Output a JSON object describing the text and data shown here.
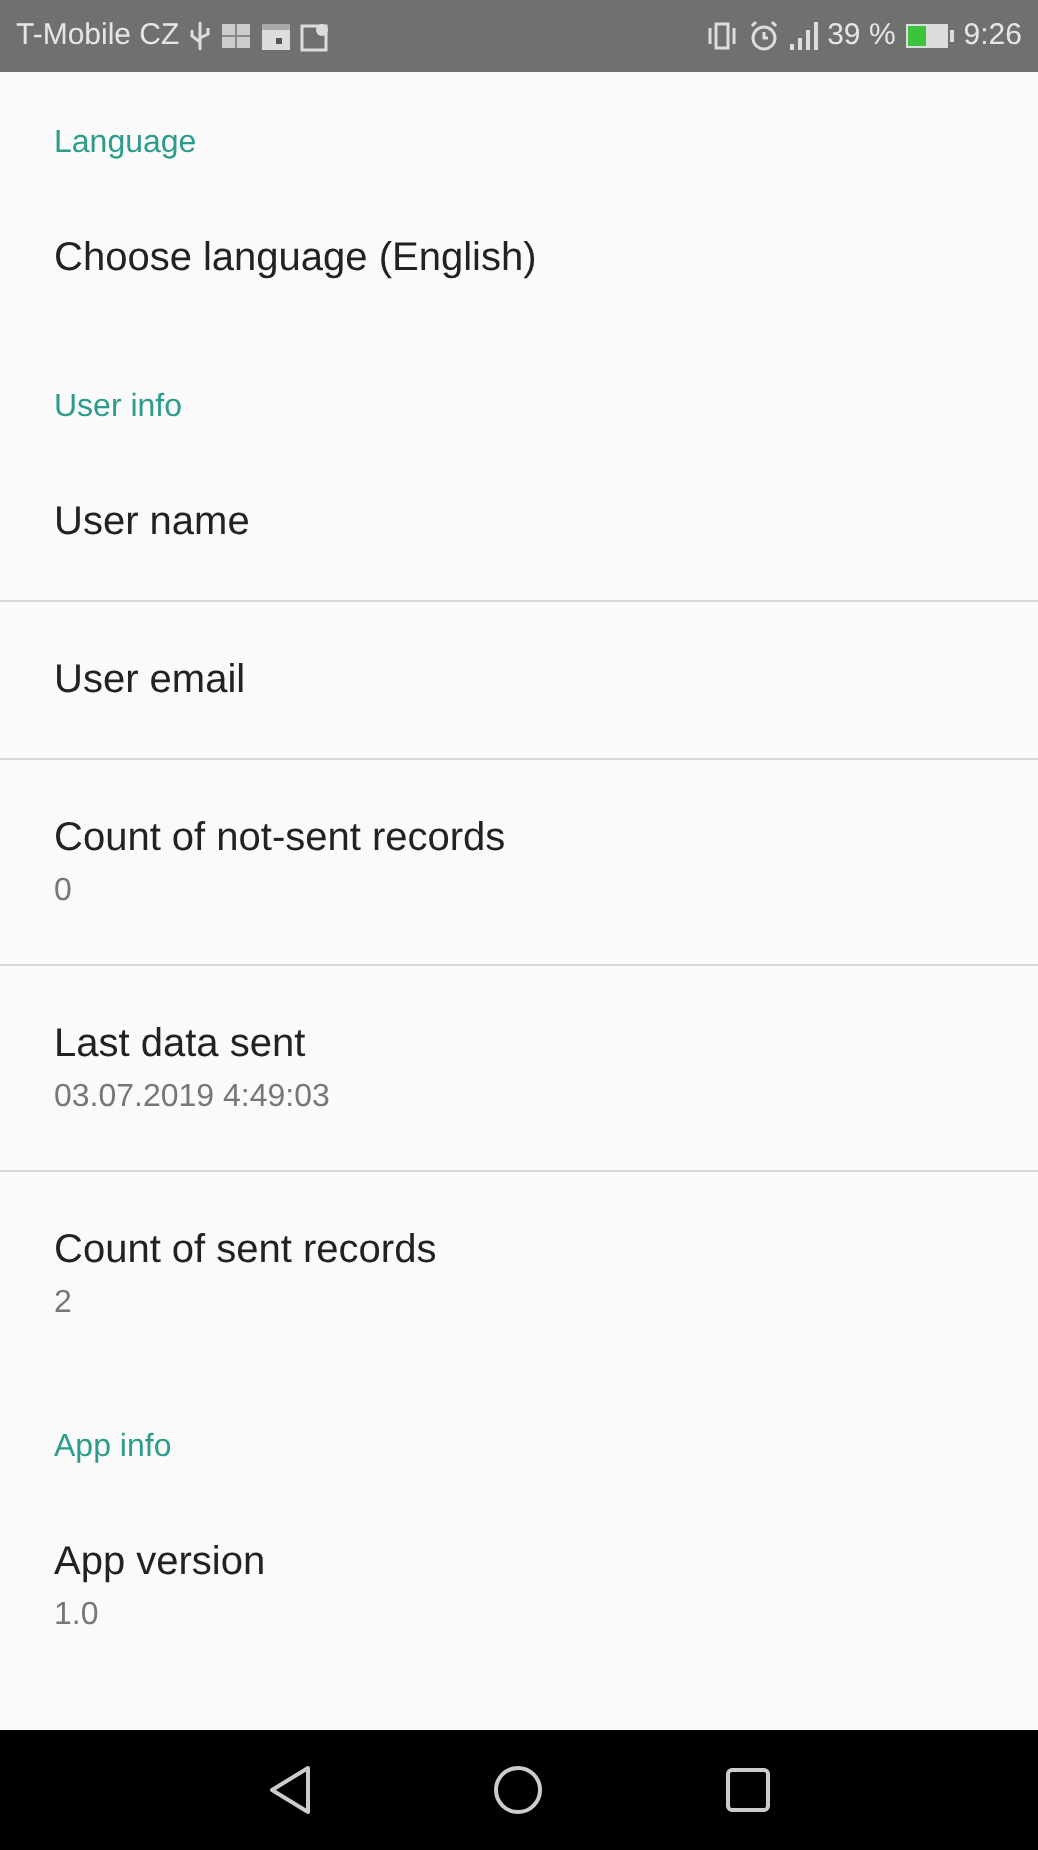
{
  "status_bar": {
    "carrier": "T-Mobile CZ",
    "battery_percent": "39 %",
    "time": "9:26"
  },
  "groups": [
    {
      "title": "Language",
      "items": [
        {
          "title": "Choose language (English)"
        }
      ]
    },
    {
      "title": "User info",
      "items": [
        {
          "title": "User name"
        },
        {
          "title": "User email"
        },
        {
          "title": "Count of not-sent records",
          "summary": "0"
        },
        {
          "title": "Last data sent",
          "summary": "03.07.2019 4:49:03"
        },
        {
          "title": "Count of sent records",
          "summary": "2"
        }
      ]
    },
    {
      "title": "App info",
      "items": [
        {
          "title": "App version",
          "summary": "1.0"
        }
      ]
    }
  ]
}
